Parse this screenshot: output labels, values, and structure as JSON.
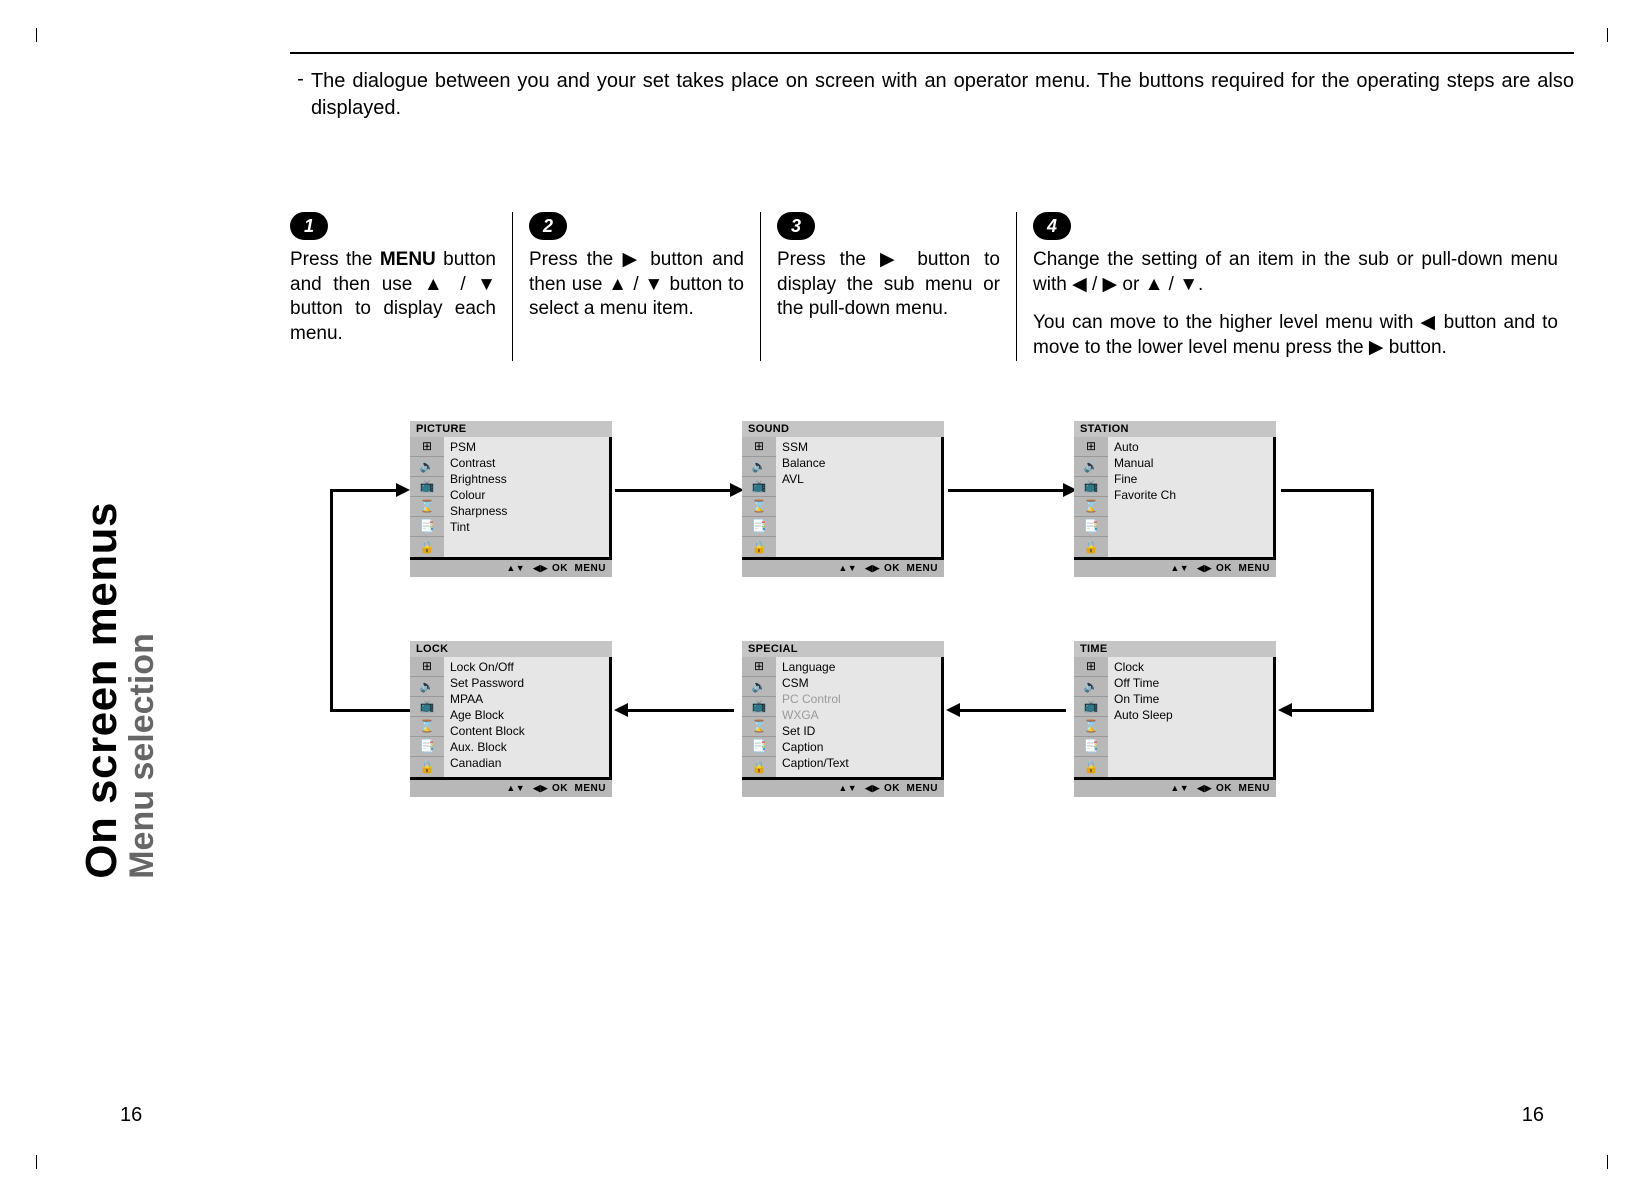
{
  "sidebar": {
    "title": "On screen menus",
    "subtitle": "Menu selection"
  },
  "intro": {
    "dash": "-",
    "text": "The dialogue between you and your set takes place on screen with an operator menu. The buttons required for the operating steps are also displayed."
  },
  "steps": [
    {
      "num": "1",
      "pre": "Press the ",
      "bold": "MENU",
      "post": " button and then use ▲ / ▼ button to display each menu."
    },
    {
      "num": "2",
      "text": "Press the ▶ button and then use ▲ / ▼ button to select a menu item."
    },
    {
      "num": "3",
      "text": "Press the ▶ button to display the sub menu or the pull-down menu."
    },
    {
      "num": "4",
      "text1": "Change the setting of an item in the sub or pull-down menu with ◀ / ▶ or ▲ / ▼.",
      "text2": "You can move to the higher level menu with ◀ button and to move to the lower level menu press the ▶ button."
    }
  ],
  "menus": {
    "picture": {
      "title": "PICTURE",
      "items": [
        "PSM",
        "Contrast",
        "Brightness",
        "Colour",
        "Sharpness",
        "Tint"
      ]
    },
    "sound": {
      "title": "SOUND",
      "items": [
        "SSM",
        "Balance",
        "AVL"
      ]
    },
    "station": {
      "title": "STATION",
      "items": [
        "Auto",
        "Manual",
        "Fine",
        "Favorite Ch"
      ]
    },
    "lock": {
      "title": "LOCK",
      "items": [
        "Lock On/Off",
        "Set Password",
        "MPAA",
        "Age Block",
        "Content Block",
        "Aux. Block",
        "Canadian"
      ]
    },
    "special": {
      "title": "SPECIAL",
      "items": [
        "Language",
        "CSM",
        "PC Control",
        "WXGA",
        "Set ID",
        "Caption",
        "Caption/Text"
      ],
      "dim": [
        2,
        3
      ]
    },
    "time": {
      "title": "TIME",
      "items": [
        "Clock",
        "Off Time",
        "On Time",
        "Auto Sleep"
      ]
    }
  },
  "footer": {
    "updown": "▲▼",
    "leftright": "◀▶",
    "ok": "OK",
    "menu": "MENU"
  },
  "icons": [
    "⊞",
    "🔈",
    "📺",
    "⌛",
    "📑",
    "🔒"
  ],
  "page_number": "16"
}
